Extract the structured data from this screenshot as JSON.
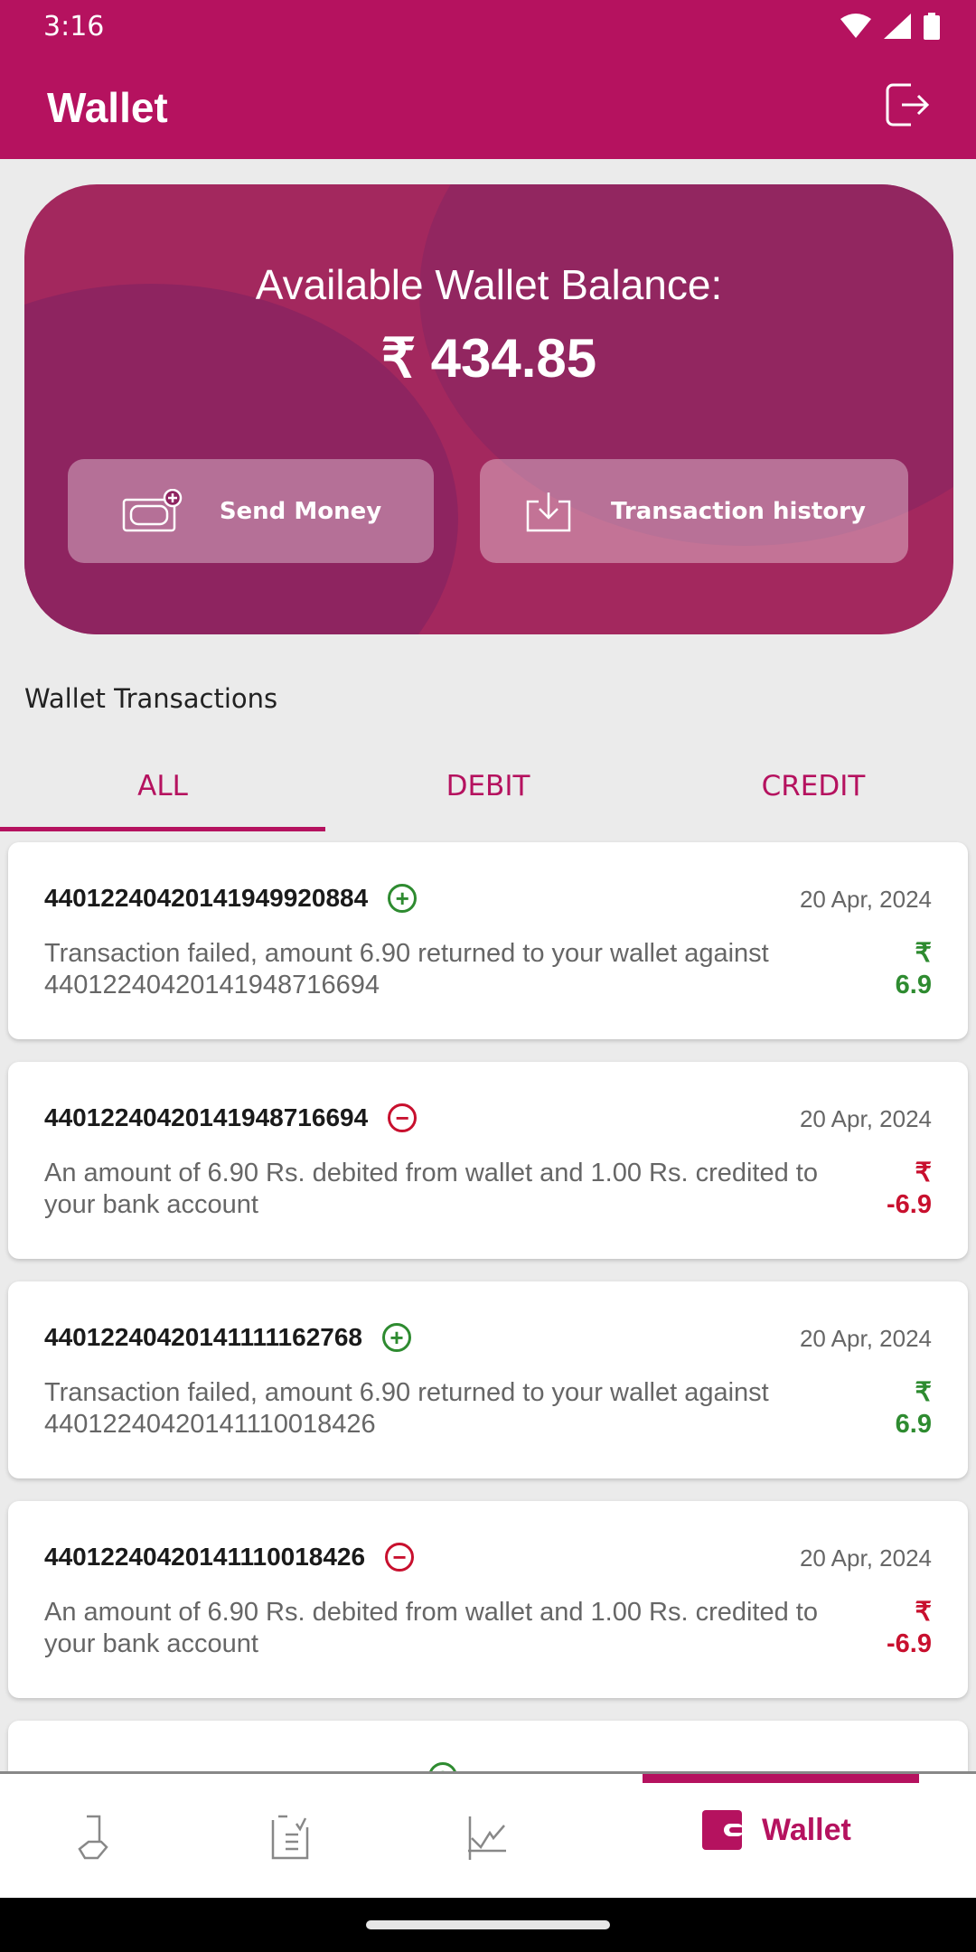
{
  "status_bar": {
    "time": "3:16"
  },
  "app_bar": {
    "title": "Wallet",
    "logout_icon": "logout-icon"
  },
  "balance": {
    "label": "Available Wallet Balance:",
    "amount": "₹ 434.85"
  },
  "actions": {
    "send_money": "Send Money",
    "transaction_history": "Transaction history"
  },
  "section_title": "Wallet Transactions",
  "tabs": [
    {
      "label": "ALL",
      "active": true
    },
    {
      "label": "DEBIT",
      "active": false
    },
    {
      "label": "CREDIT",
      "active": false
    }
  ],
  "transactions": [
    {
      "id": "440122404201419499208 84",
      "type": "credit",
      "date": "20 Apr, 2024",
      "description": "Transaction failed, amount 6.90 returned to your wallet against 44012240420141948716694",
      "currency": "₹",
      "amount": "6.9"
    },
    {
      "id": "44012240420141948716694",
      "type": "debit",
      "date": "20 Apr, 2024",
      "description": "An amount of 6.90 Rs. debited from wallet and 1.00 Rs. credited to your bank account",
      "currency": "₹",
      "amount": "-6.9"
    },
    {
      "id": "44012240420141111162768",
      "type": "credit",
      "date": "20 Apr, 2024",
      "description": "Transaction failed, amount 6.90 returned to your wallet against 44012240420141110018426",
      "currency": "₹",
      "amount": "6.9"
    },
    {
      "id": "44012240420141110018426",
      "type": "debit",
      "date": "20 Apr, 2024",
      "description": "An amount of 6.90 Rs. debited from wallet and 1.00 Rs. credited to your bank account",
      "currency": "₹",
      "amount": "-6.9"
    }
  ],
  "bottom_nav": {
    "active_label": "Wallet"
  },
  "colors": {
    "brand": "#b5125f",
    "credit": "#2e8b30",
    "debit": "#c8102e"
  }
}
